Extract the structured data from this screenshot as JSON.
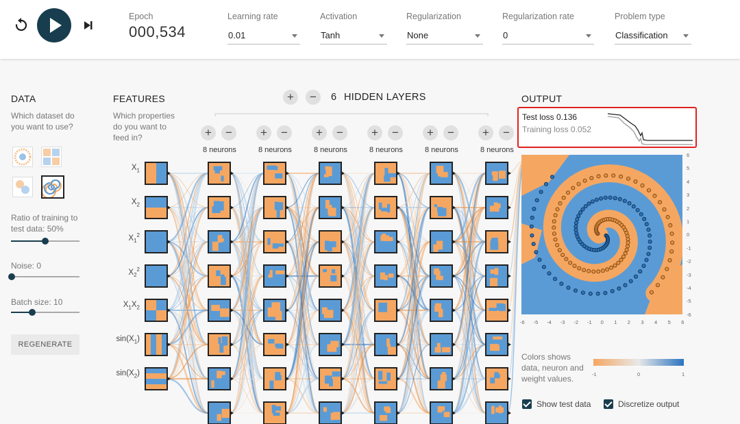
{
  "header": {
    "epoch_label": "Epoch",
    "epoch_value": "000,534",
    "controls": [
      {
        "label": "Learning rate",
        "value": "0.01"
      },
      {
        "label": "Activation",
        "value": "Tanh"
      },
      {
        "label": "Regularization",
        "value": "None"
      },
      {
        "label": "Regularization rate",
        "value": "0"
      },
      {
        "label": "Problem type",
        "value": "Classification"
      }
    ]
  },
  "data_panel": {
    "title": "DATA",
    "question": "Which dataset do you want to use?",
    "ratio_label": "Ratio of training to test data:  50%",
    "ratio": 0.5,
    "noise_label": "Noise:  0",
    "noise": 0,
    "batch_label": "Batch size:  10",
    "batch": 0.3,
    "regenerate": "REGENERATE"
  },
  "features_panel": {
    "title": "FEATURES",
    "question": "Which properties do you want to feed in?",
    "features": [
      {
        "base": "X",
        "sub": "1",
        "sup": "",
        "name": "x1"
      },
      {
        "base": "X",
        "sub": "2",
        "sup": "",
        "name": "x2"
      },
      {
        "base": "X",
        "sub": "1",
        "sup": "2",
        "name": "x1-squared"
      },
      {
        "base": "X",
        "sub": "2",
        "sup": "2",
        "name": "x2-squared"
      },
      {
        "base": "X",
        "sub": "1",
        "sup": "",
        "extra": "X",
        "extra_sub": "2",
        "name": "x1x2"
      },
      {
        "base": "sin(X",
        "sub": "1",
        "sup": "",
        "close": ")",
        "name": "sin-x1"
      },
      {
        "base": "sin(X",
        "sub": "2",
        "sup": "",
        "close": ")",
        "name": "sin-x2"
      }
    ]
  },
  "network": {
    "layer_count": "6",
    "hidden_layers_label": "HIDDEN LAYERS",
    "plus": "+",
    "minus": "−",
    "layers": [
      {
        "neurons_label": "8 neurons"
      },
      {
        "neurons_label": "8 neurons"
      },
      {
        "neurons_label": "8 neurons"
      },
      {
        "neurons_label": "8 neurons"
      },
      {
        "neurons_label": "8 neurons"
      },
      {
        "neurons_label": "8 neurons"
      }
    ]
  },
  "output": {
    "title": "OUTPUT",
    "test_loss": "Test loss 0.136",
    "training_loss": "Training loss 0.052",
    "x_ticks": [
      "-6",
      "-5",
      "-4",
      "-3",
      "-2",
      "-1",
      "0",
      "1",
      "2",
      "3",
      "4",
      "5",
      "6"
    ],
    "y_ticks": [
      "6",
      "5",
      "4",
      "3",
      "2",
      "1",
      "0",
      "-1",
      "-2",
      "-3",
      "-4",
      "-5",
      "-6"
    ],
    "colors_text": "Colors shows data, neuron and weight values.",
    "legend_ticks": [
      "-1",
      "0",
      "1"
    ],
    "show_test_data": "Show test data",
    "discretize_output": "Discretize output"
  },
  "colors": {
    "orange": "#f5a762",
    "blue": "#5b9bd5",
    "dark": "#183d4e",
    "highlight": "#e02020"
  }
}
